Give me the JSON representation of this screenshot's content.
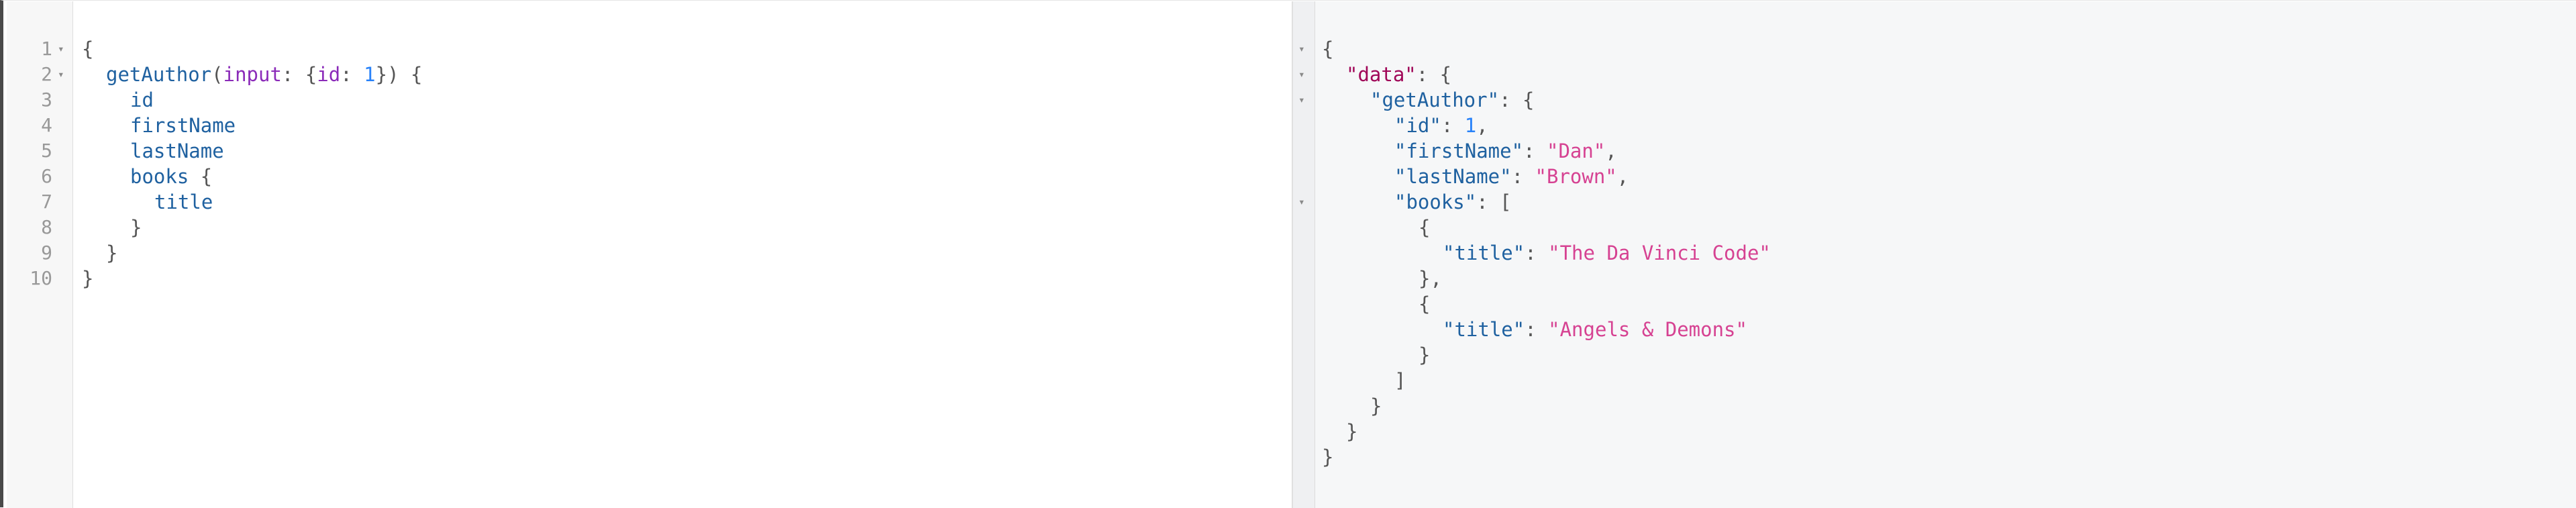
{
  "query_editor": {
    "line_numbers": [
      "1",
      "2",
      "3",
      "4",
      "5",
      "6",
      "7",
      "8",
      "9",
      "10"
    ],
    "lines": {
      "l1_open": "{",
      "l2_field": "getAuthor",
      "l2_paren_open": "(",
      "l2_arg_name": "input",
      "l2_colon_brace": ": {",
      "l2_inner_arg": "id",
      "l2_colon": ": ",
      "l2_value": "1",
      "l2_close": "}) {",
      "l3_field": "id",
      "l4_field": "firstName",
      "l5_field": "lastName",
      "l6_field": "books",
      "l6_brace": " {",
      "l7_field": "title",
      "l8_close": "}",
      "l9_close": "}",
      "l10_close": "}"
    }
  },
  "result_viewer": {
    "r1": "{",
    "r2_key": "\"data\"",
    "r2_rest": ": {",
    "r3_key": "\"getAuthor\"",
    "r3_rest": ": {",
    "r4_key": "\"id\"",
    "r4_colon": ": ",
    "r4_value": "1",
    "r4_comma": ",",
    "r5_key": "\"firstName\"",
    "r5_colon": ": ",
    "r5_value": "\"Dan\"",
    "r5_comma": ",",
    "r6_key": "\"lastName\"",
    "r6_colon": ": ",
    "r6_value": "\"Brown\"",
    "r6_comma": ",",
    "r7_key": "\"books\"",
    "r7_rest": ": [",
    "r8": "{",
    "r9_key": "\"title\"",
    "r9_colon": ": ",
    "r9_value": "\"The Da Vinci Code\"",
    "r10": "},",
    "r11": "{",
    "r12_key": "\"title\"",
    "r12_colon": ": ",
    "r12_value": "\"Angels & Demons\"",
    "r13": "}",
    "r14": "]",
    "r15": "}",
    "r16": "}",
    "r17": "}"
  },
  "icons": {
    "fold": "▾"
  },
  "colors": {
    "field": "#1f61a0",
    "argument": "#8b2bb9",
    "number": "#2882f9",
    "root_key": "#a00758",
    "string": "#d64292"
  }
}
